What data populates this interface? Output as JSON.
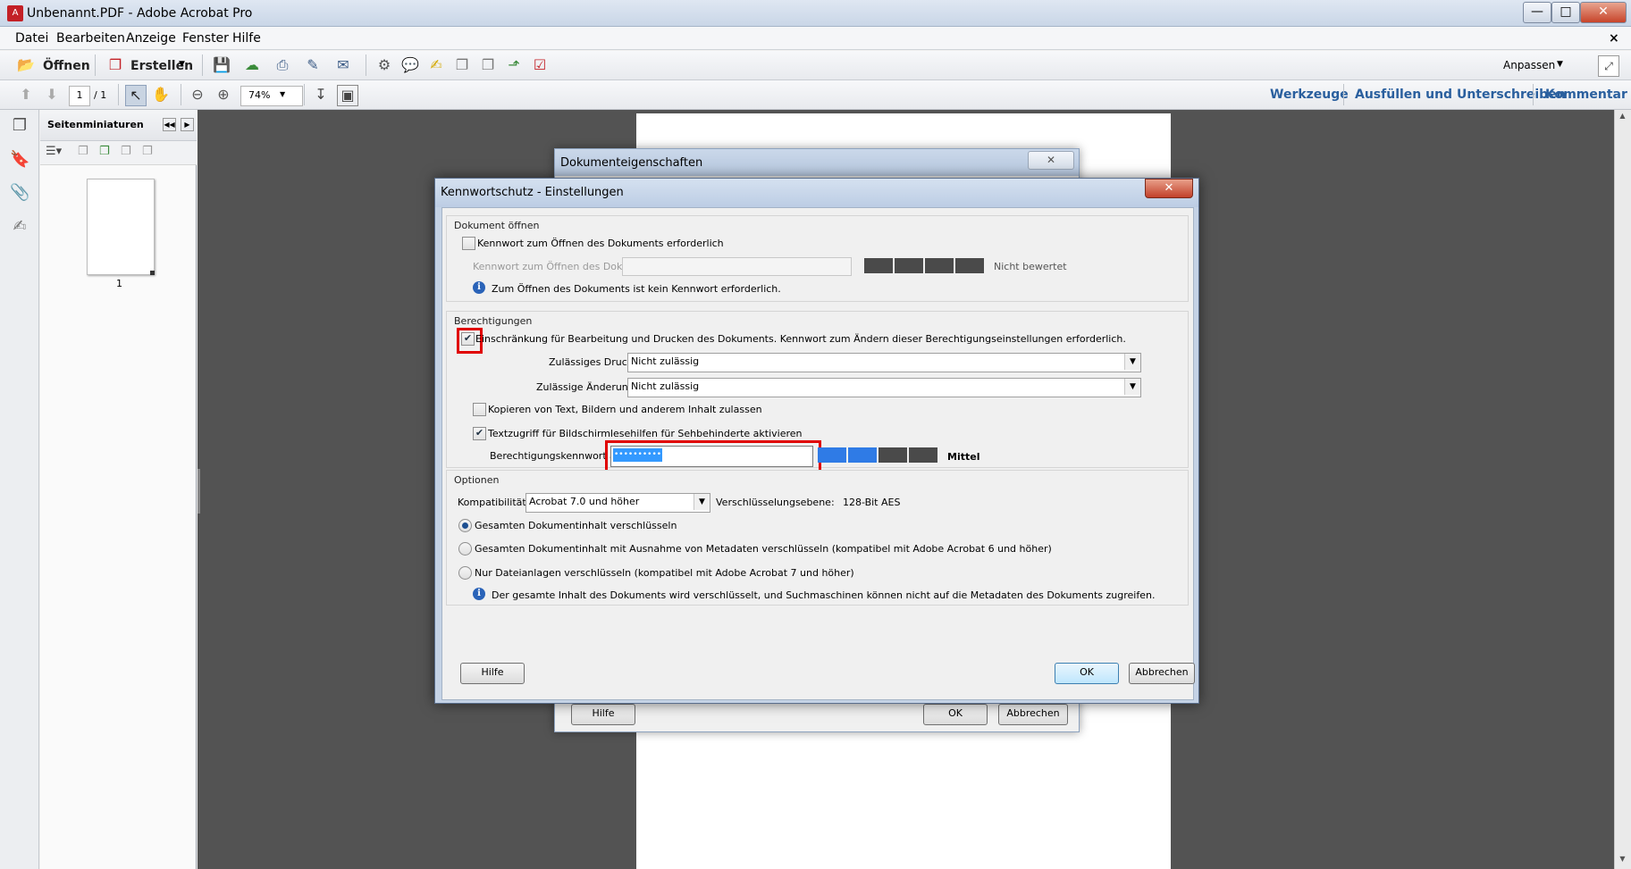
{
  "window": {
    "title": "Unbenannt.PDF - Adobe Acrobat Pro",
    "background_title": "",
    "controls": [
      "—",
      "□",
      "✕"
    ]
  },
  "menubar": {
    "items": [
      "Datei",
      "Bearbeiten",
      "Anzeige",
      "Fenster",
      "Hilfe"
    ],
    "close_glyph": "×"
  },
  "toolbar1": {
    "open_label": "Öffnen",
    "create_label": "Erstellen",
    "customize_label": "Anpassen"
  },
  "toolbar2": {
    "page_current": "1",
    "page_total": "/ 1",
    "zoom": "74%",
    "tabs": [
      "Werkzeuge",
      "Ausfüllen und Unterschreiben",
      "Kommentar"
    ]
  },
  "sidebar": {
    "title": "Seitenminiaturen",
    "thumb_label": "1"
  },
  "back_dialog": {
    "title": "Dokumenteigenschaften",
    "help": "Hilfe",
    "ok": "OK",
    "cancel": "Abbrechen"
  },
  "dialog": {
    "title": "Kennwortschutz - Einstellungen",
    "open_doc": {
      "heading": "Dokument öffnen",
      "require_checkbox": "Kennwort zum Öffnen des Dokuments erforderlich",
      "require_checked": false,
      "password_label": "Kennwort zum Öffnen des Dokuments:",
      "rating": "Nicht bewertet",
      "info": "Zum Öffnen des Dokuments ist kein Kennwort erforderlich."
    },
    "permissions": {
      "heading": "Berechtigungen",
      "restrict_checkbox": "Einschränkung für Bearbeitung und Drucken des Dokuments. Kennwort zum Ändern dieser Berechtigungseinstellungen erforderlich.",
      "restrict_checked": true,
      "printing_label": "Zulässiges Drucken:",
      "printing_value": "Nicht zulässig",
      "changes_label": "Zulässige Änderungen:",
      "changes_value": "Nicht zulässig",
      "copy_checkbox": "Kopieren von Text, Bildern und anderem Inhalt zulassen",
      "copy_checked": false,
      "access_checkbox": "Textzugriff für Bildschirmlesehilfen für Sehbehinderte aktivieren",
      "access_checked": true,
      "change_pw_label": "Berechtigungskennwort ändern:",
      "change_pw_value": "••••••••••",
      "strength": "Mittel",
      "strength_segments_filled": 2,
      "strength_segments_total": 4
    },
    "options": {
      "heading": "Optionen",
      "compat_label": "Kompatibilität:",
      "compat_value": "Acrobat 7.0 und höher",
      "encryption_label": "Verschlüsselungsebene:",
      "encryption_value": "128-Bit AES",
      "radio_all": "Gesamten Dokumentinhalt verschlüsseln",
      "radio_except_meta": "Gesamten Dokumentinhalt mit Ausnahme von Metadaten verschlüsseln (kompatibel mit Adobe Acrobat 6 und höher)",
      "radio_attachments": "Nur Dateianlagen verschlüsseln (kompatibel mit Adobe Acrobat 7 und höher)",
      "selected": "radio_all",
      "info": "Der gesamte Inhalt des Dokuments wird verschlüsselt, und Suchmaschinen können nicht auf die Metadaten des Dokuments zugreifen."
    },
    "buttons": {
      "help": "Hilfe",
      "ok": "OK",
      "cancel": "Abbrechen"
    }
  },
  "colors": {
    "meter_filled": "#2f7be6",
    "meter_empty": "#4a4a4a",
    "highlight": "#e00000",
    "accent_link": "#2a5f9e"
  }
}
